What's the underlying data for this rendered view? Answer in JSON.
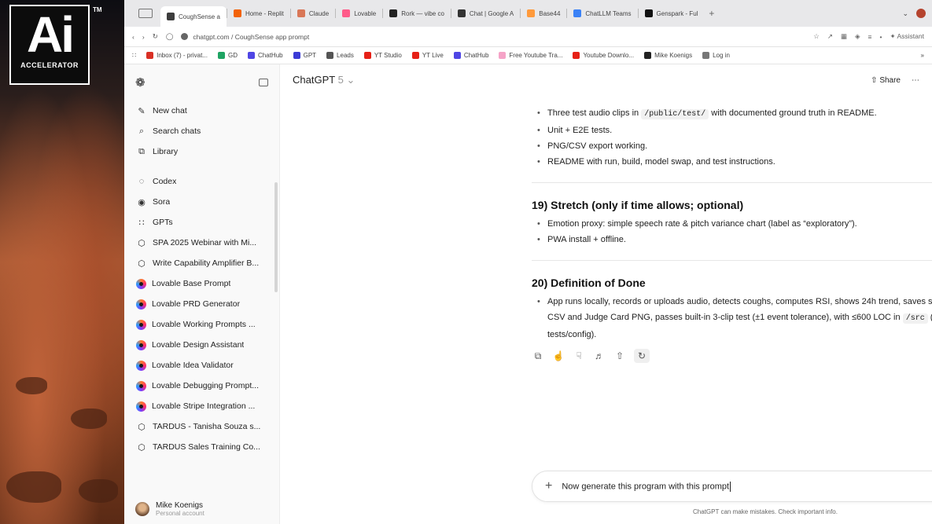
{
  "brand": {
    "logo_text": "Ai",
    "logo_sub": "ACCELERATOR",
    "tm": "TM"
  },
  "tabs": [
    {
      "label": "CoughSense a",
      "color": "#3d3d3d",
      "active": true
    },
    {
      "label": "Home - Replit",
      "color": "#f26207"
    },
    {
      "label": "Claude",
      "color": "#d97757"
    },
    {
      "label": "Lovable",
      "color": "#ff5b8a"
    },
    {
      "label": "Rork — vibe co",
      "color": "#222222"
    },
    {
      "label": "Chat | Google A",
      "color": "#333333"
    },
    {
      "label": "Base44",
      "color": "#ff9a3c"
    },
    {
      "label": "ChatLLM Teams",
      "color": "#3b82f6"
    },
    {
      "label": "Genspark - Ful",
      "color": "#111111"
    }
  ],
  "address": {
    "url": "chatgpt.com / CoughSense app prompt",
    "assistant": "Assistant"
  },
  "bookmarks": [
    {
      "label": "Inbox (7) - privat...",
      "color": "#d93025"
    },
    {
      "label": "GD",
      "color": "#1fa463"
    },
    {
      "label": "ChatHub",
      "color": "#4f46e5"
    },
    {
      "label": "GPT",
      "color": "#3b3bd6"
    },
    {
      "label": "Leads",
      "color": "#555555"
    },
    {
      "label": "YT Studio",
      "color": "#e62117"
    },
    {
      "label": "YT Live",
      "color": "#e62117"
    },
    {
      "label": "ChatHub",
      "color": "#4f46e5"
    },
    {
      "label": "Free Youtube Tra...",
      "color": "#f5a3c7"
    },
    {
      "label": "Youtube Downlo...",
      "color": "#e62117"
    },
    {
      "label": "Mike Koenigs",
      "color": "#222222"
    },
    {
      "label": "Log in",
      "color": "#777777"
    }
  ],
  "sidebar": {
    "actions": [
      {
        "label": "New chat",
        "icon": "edit-icon"
      },
      {
        "label": "Search chats",
        "icon": "search-icon"
      },
      {
        "label": "Library",
        "icon": "library-icon"
      }
    ],
    "apps": [
      {
        "label": "Codex",
        "icon": "codex-icon"
      },
      {
        "label": "Sora",
        "icon": "sora-icon"
      },
      {
        "label": "GPTs",
        "icon": "gpts-icon"
      }
    ],
    "chats": [
      {
        "label": "SPA 2025 Webinar with Mi...",
        "type": "cube"
      },
      {
        "label": "Write Capability Amplifier B...",
        "type": "cube"
      },
      {
        "label": "Lovable Base Prompt",
        "type": "lovable"
      },
      {
        "label": "Lovable PRD Generator",
        "type": "lovable"
      },
      {
        "label": "Lovable Working Prompts ...",
        "type": "lovable"
      },
      {
        "label": "Lovable Design Assistant",
        "type": "lovable"
      },
      {
        "label": "Lovable Idea Validator",
        "type": "lovable"
      },
      {
        "label": "Lovable Debugging Prompt...",
        "type": "lovable"
      },
      {
        "label": "Lovable Stripe Integration ...",
        "type": "lovable"
      },
      {
        "label": "TARDUS - Tanisha Souza s...",
        "type": "cube"
      },
      {
        "label": "TARDUS Sales Training Co...",
        "type": "cube"
      }
    ],
    "user": {
      "name": "Mike Koenigs",
      "sub": "Personal account"
    }
  },
  "header": {
    "model": "ChatGPT",
    "version": "5",
    "share": "Share"
  },
  "content": {
    "top_bullets": {
      "b1_pre": "Three test audio clips in ",
      "b1_code": "/public/test/",
      "b1_post": " with documented ground truth in README.",
      "b2": "Unit + E2E tests.",
      "b3": "PNG/CSV export working.",
      "b4": "README with run, build, model swap, and test instructions."
    },
    "s19": {
      "title": "19) Stretch (only if time allows; optional)",
      "b1": "Emotion proxy: simple speech rate & pitch variance chart (label as “exploratory”).",
      "b2": "PWA install + offline."
    },
    "s20": {
      "title": "20) Definition of Done",
      "b1_pre": "App runs locally, records or uploads audio, detects coughs, computes RSI, shows 24h trend, saves sessions, exports CSV and Judge Card PNG, passes built-in 3-clip test (±1 event tolerance), with ≤600 LOC in ",
      "b1_code": "/src",
      "b1_post": " (not counting tests/config)."
    }
  },
  "composer": {
    "text": "Now generate this program with this prompt"
  },
  "disclaimer": "ChatGPT can make mistakes. Check important info."
}
